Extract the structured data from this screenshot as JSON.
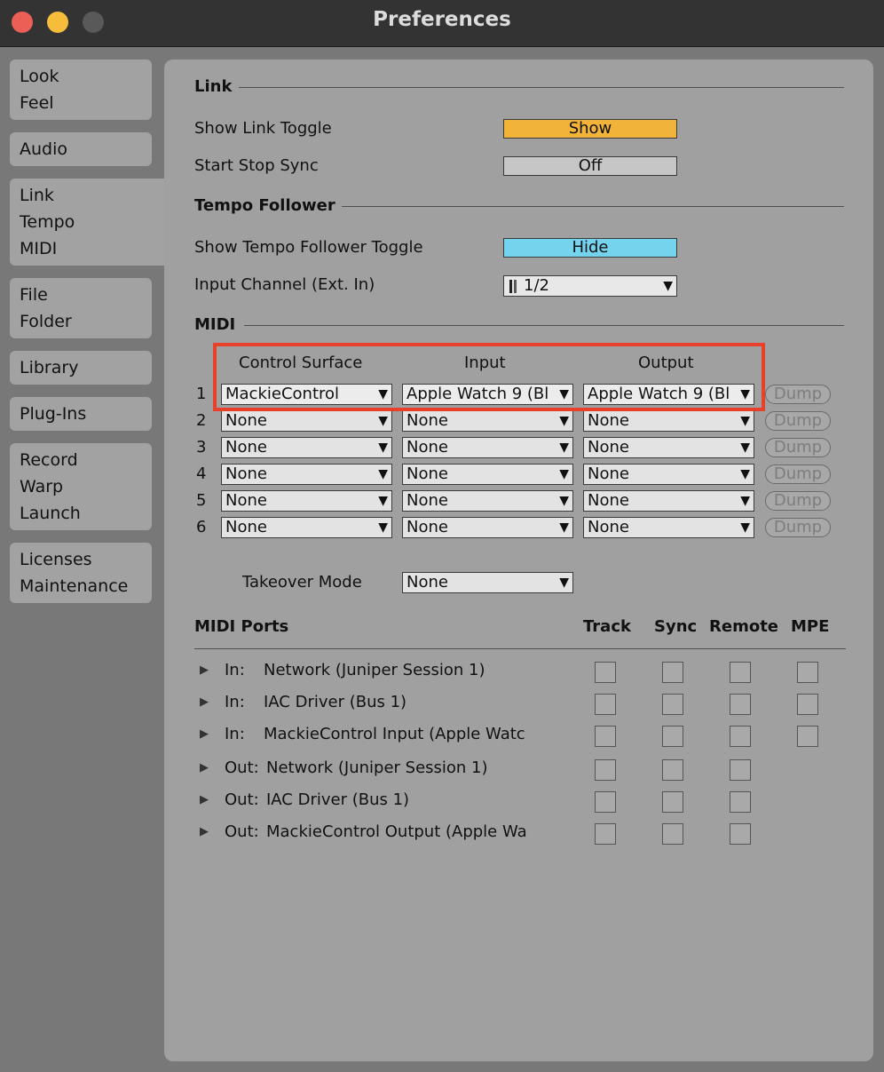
{
  "window": {
    "title": "Preferences"
  },
  "sidebar": [
    {
      "id": "look-feel",
      "lines": [
        "Look",
        "Feel"
      ]
    },
    {
      "id": "audio",
      "lines": [
        "Audio"
      ]
    },
    {
      "id": "link-tempo-midi",
      "lines": [
        "Link",
        "Tempo",
        "MIDI"
      ],
      "active": true
    },
    {
      "id": "file-folder",
      "lines": [
        "File",
        "Folder"
      ]
    },
    {
      "id": "library",
      "lines": [
        "Library"
      ]
    },
    {
      "id": "plug-ins",
      "lines": [
        "Plug-Ins"
      ]
    },
    {
      "id": "record-warp-launch",
      "lines": [
        "Record",
        "Warp",
        "Launch"
      ]
    },
    {
      "id": "licenses-maintenance",
      "lines": [
        "Licenses",
        "Maintenance"
      ]
    }
  ],
  "link": {
    "heading": "Link",
    "show_toggle_label": "Show Link Toggle",
    "show_toggle_value": "Show",
    "start_stop_label": "Start Stop Sync",
    "start_stop_value": "Off"
  },
  "tempo": {
    "heading": "Tempo Follower",
    "show_toggle_label": "Show Tempo Follower Toggle",
    "show_toggle_value": "Hide",
    "input_channel_label": "Input Channel (Ext. In)",
    "input_channel_value": "1/2"
  },
  "midi": {
    "heading": "MIDI",
    "col_control_surface": "Control Surface",
    "col_input": "Input",
    "col_output": "Output",
    "dump_label": "Dump",
    "rows": [
      {
        "num": "1",
        "surface": "MackieControl",
        "input": "Apple Watch 9 (Bl",
        "output": "Apple Watch 9 (Bl"
      },
      {
        "num": "2",
        "surface": "None",
        "input": "None",
        "output": "None"
      },
      {
        "num": "3",
        "surface": "None",
        "input": "None",
        "output": "None"
      },
      {
        "num": "4",
        "surface": "None",
        "input": "None",
        "output": "None"
      },
      {
        "num": "5",
        "surface": "None",
        "input": "None",
        "output": "None"
      },
      {
        "num": "6",
        "surface": "None",
        "input": "None",
        "output": "None"
      }
    ],
    "takeover_label": "Takeover Mode",
    "takeover_value": "None"
  },
  "ports": {
    "heading": "MIDI Ports",
    "col_track": "Track",
    "col_sync": "Sync",
    "col_remote": "Remote",
    "col_mpe": "MPE",
    "rows": [
      {
        "dir": "In:",
        "name": "Network (Juniper Session 1)",
        "mpe": true
      },
      {
        "dir": "In:",
        "name": "IAC Driver (Bus 1)",
        "mpe": true
      },
      {
        "dir": "In:",
        "name": "MackieControl Input (Apple Watc",
        "mpe": true
      },
      {
        "dir": "Out:",
        "name": "Network (Juniper Session 1)",
        "mpe": false
      },
      {
        "dir": "Out:",
        "name": "IAC Driver (Bus 1)",
        "mpe": false
      },
      {
        "dir": "Out:",
        "name": "MackieControl Output (Apple Wa",
        "mpe": false
      }
    ]
  },
  "colors": {
    "show_button": "#f2b33a",
    "hide_button": "#74d4ed",
    "highlight_box": "#e8412b"
  },
  "icons": {
    "close": "close-icon",
    "minimize": "minimize-icon",
    "maximize": "maximize-icon",
    "dropdown": "dropdown-arrow-icon",
    "disclosure": "disclosure-triangle-icon"
  }
}
